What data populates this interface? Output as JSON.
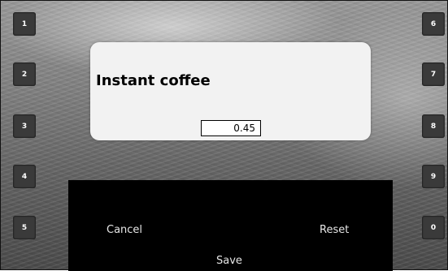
{
  "left_buttons": [
    "1",
    "2",
    "3",
    "4",
    "5"
  ],
  "right_buttons": [
    "6",
    "7",
    "8",
    "9",
    "0"
  ],
  "dialog": {
    "title": "Instant coffee",
    "value": "0.45"
  },
  "softkeys": {
    "cancel": "Cancel",
    "reset": "Reset",
    "save": "Save"
  }
}
